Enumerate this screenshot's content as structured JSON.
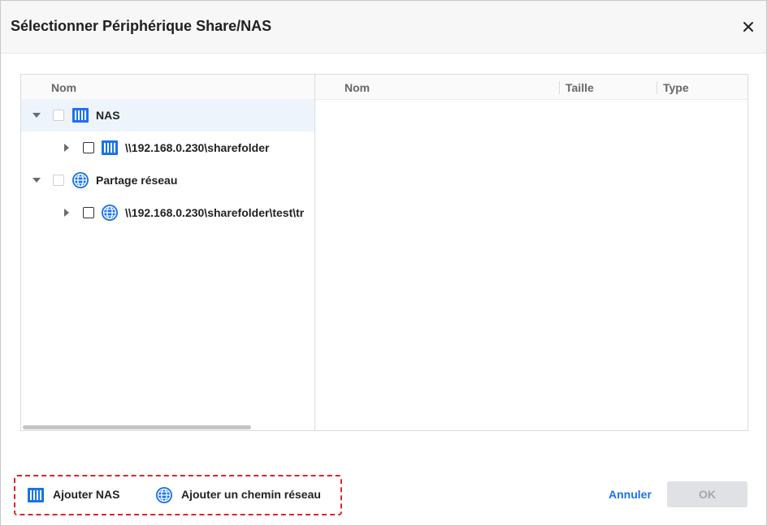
{
  "dialog": {
    "title": "Sélectionner Périphérique Share/NAS",
    "close_icon": "close-icon"
  },
  "tree": {
    "header": "Nom",
    "items": [
      {
        "label": "NAS",
        "icon": "nas-icon",
        "expanded": true,
        "selected": true
      },
      {
        "label": "\\\\192.168.0.230\\sharefolder",
        "icon": "nas-icon",
        "expanded": false
      },
      {
        "label": "Partage réseau",
        "icon": "globe-icon",
        "expanded": true
      },
      {
        "label": "\\\\192.168.0.230\\sharefolder\\test\\tr",
        "icon": "globe-icon",
        "expanded": false
      }
    ]
  },
  "list": {
    "columns": [
      "Nom",
      "Taille",
      "Type"
    ]
  },
  "footer": {
    "add_nas": "Ajouter NAS",
    "add_network_path": "Ajouter un chemin réseau",
    "cancel": "Annuler",
    "ok": "OK"
  },
  "colors": {
    "accent": "#1a73e8",
    "highlight_border": "#e0252a",
    "selected_row": "#eef4fb",
    "disabled_button": "#dfe1e4"
  }
}
